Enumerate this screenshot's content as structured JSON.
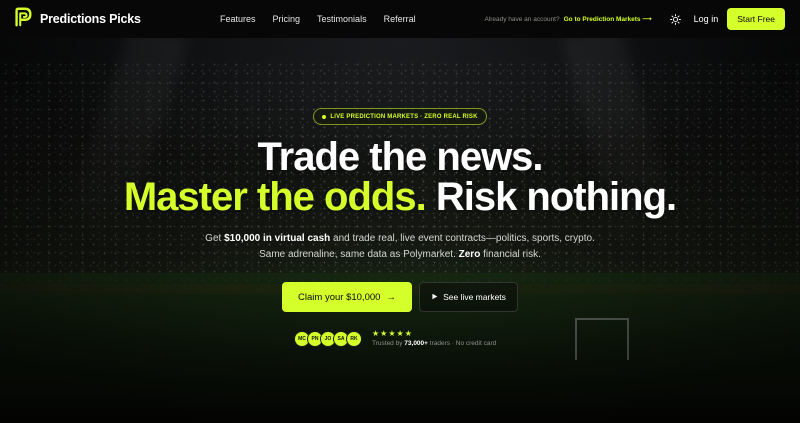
{
  "brand": {
    "name": "Predictions Picks",
    "accent": "#d4ff2a"
  },
  "nav": {
    "items": [
      "Features",
      "Pricing",
      "Testimonials",
      "Referral"
    ]
  },
  "header": {
    "already_text": "Already have an account?",
    "goto_link": "Go to Prediction Markets ⟶",
    "theme_icon": "sun-icon",
    "login": "Log in",
    "start_free": "Start Free"
  },
  "hero": {
    "pill": "LIVE PREDICTION MARKETS · ZERO REAL RISK",
    "headline_1": "Trade the news.",
    "headline_2_accent": "Master the odds.",
    "headline_2_rest": " Risk nothing.",
    "sub1_pre": "Get ",
    "sub1_bold": "$10,000 in virtual cash",
    "sub1_post": " and trade real, live event contracts—politics, sports, crypto.",
    "sub2_pre": "Same adrenaline, same data as Polymarket. ",
    "sub2_bold": "Zero",
    "sub2_post": " financial risk.",
    "cta_label": "Claim your $10,000",
    "cta_arrow": "→",
    "live_label": "See live markets",
    "live_icon": "play-icon"
  },
  "social_proof": {
    "avatars": [
      "MC",
      "PN",
      "JO",
      "SA",
      "RK"
    ],
    "stars": "★★★★★",
    "rating": 5,
    "trusted_pre": "Trusted by ",
    "trusted_count": "73,000+",
    "trusted_post": " traders · No credit card"
  }
}
